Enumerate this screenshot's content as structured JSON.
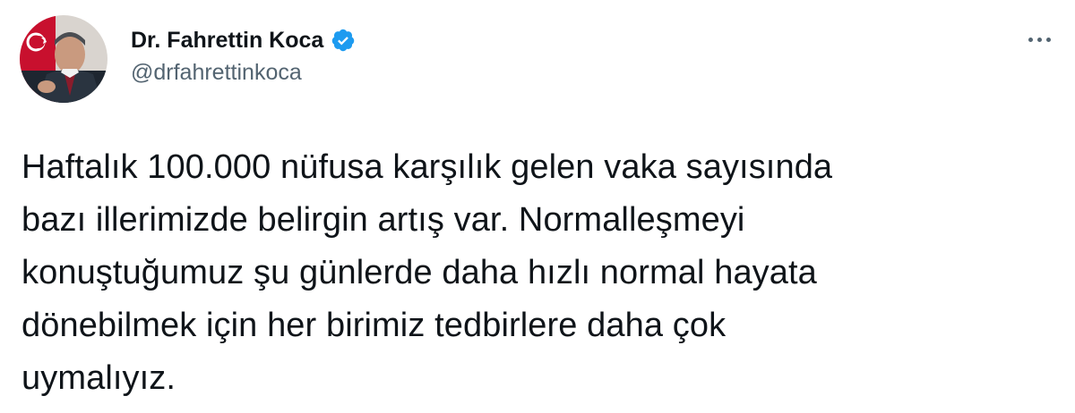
{
  "author": {
    "display_name": "Dr. Fahrettin Koca",
    "handle": "@drfahrettinkoca",
    "verified_icon": "verified-badge-icon",
    "avatar_icon": "profile-photo"
  },
  "menu": {
    "more_icon": "more-options-icon"
  },
  "tweet": {
    "lines": [
      "Haftalık 100.000 nüfusa karşılık gelen vaka sayısında",
      "bazı illerimizde belirgin artış var. Normalleşmeyi",
      "konuştuğumuz şu günlerde daha hızlı normal hayata",
      "dönebilmek için her birimiz tedbirlere daha çok",
      "uymalıyız."
    ]
  },
  "colors": {
    "text_primary": "#0f1419",
    "text_secondary": "#536471",
    "verified_blue": "#1d9bf0",
    "background": "#ffffff"
  }
}
